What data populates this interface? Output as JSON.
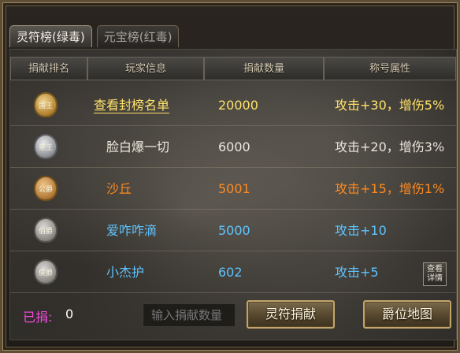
{
  "tabs": [
    {
      "label": "灵符榜(绿毒)",
      "active": true
    },
    {
      "label": "元宝榜(红毒)",
      "active": false
    }
  ],
  "table": {
    "headers": [
      "捐献排名",
      "玩家信息",
      "捐献数量",
      "称号属性"
    ],
    "rows": [
      {
        "badge": "国王",
        "badge_style": "gold",
        "player": "查看封榜名单",
        "amount": "20000",
        "attr": "攻击+30，增伤5%",
        "color": "#ffe26a",
        "amount_color": "#ffe26a"
      },
      {
        "badge": "亲王",
        "badge_style": "silver",
        "player": "脸白爆一切",
        "amount": "6000",
        "attr": "攻击+20，增伤3%",
        "color": "#ece7dc",
        "amount_color": "#ece7dc"
      },
      {
        "badge": "公爵",
        "badge_style": "bronze",
        "player": "沙丘",
        "amount": "5001",
        "attr": "攻击+15，增伤1%",
        "color": "#ff8a1e",
        "amount_color": "#ff8a1e"
      },
      {
        "badge": "伯爵",
        "badge_style": "gray",
        "player": "爱咋咋滴",
        "amount": "5000",
        "attr": "攻击+10",
        "color": "#5ec4ff",
        "amount_color": "#5ec4ff"
      },
      {
        "badge": "侯爵",
        "badge_style": "gray",
        "player": "小杰护",
        "amount": "602",
        "attr": "攻击+5",
        "color": "#5ec4ff",
        "amount_color": "#5ec4ff"
      }
    ],
    "detail_button": "查看详情"
  },
  "footer": {
    "donated_label": "已捐:",
    "donated_value": "0",
    "input_placeholder": "输入捐献数量",
    "donate_button": "灵符捐献",
    "map_button": "爵位地图"
  },
  "colors": {
    "gold_text": "#ffe26a",
    "orange_text": "#ff8a1e",
    "blue_text": "#5ec4ff",
    "magenta_label": "#f04bdc"
  }
}
